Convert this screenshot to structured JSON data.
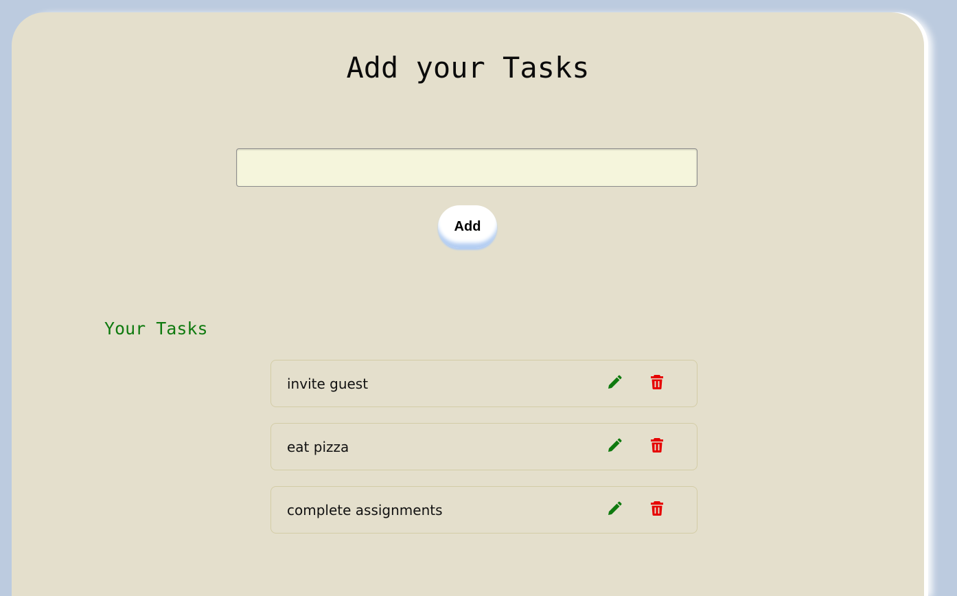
{
  "header": {
    "title": "Add your Tasks"
  },
  "input": {
    "value": "",
    "placeholder": ""
  },
  "add_button": {
    "label": "Add"
  },
  "tasks_section": {
    "title": "Your Tasks",
    "tasks": [
      {
        "text": "invite guest",
        "edit_icon": "pencil-icon",
        "delete_icon": "trash-icon"
      },
      {
        "text": "eat pizza",
        "edit_icon": "pencil-icon",
        "delete_icon": "trash-icon"
      },
      {
        "text": "complete assignments",
        "edit_icon": "pencil-icon",
        "delete_icon": "trash-icon"
      }
    ]
  },
  "colors": {
    "background": "#bccbdf",
    "card": "#e4dfcc",
    "input_bg": "#f5f5dc",
    "section_title": "#0f7a0f",
    "edit_icon": "#0f7a0f",
    "delete_icon": "#e60000"
  }
}
